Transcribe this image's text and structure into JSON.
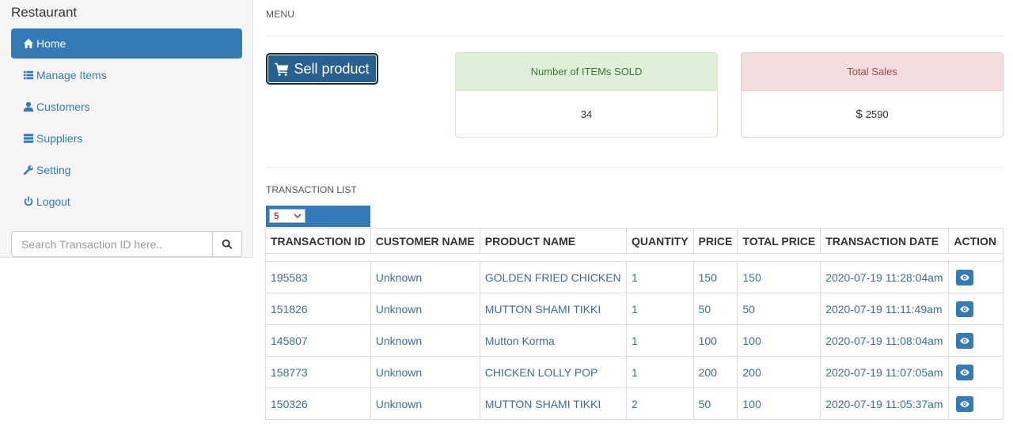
{
  "sidebar": {
    "brand": "Restaurant",
    "items": [
      {
        "label": "Home",
        "icon": "home-icon",
        "active": true
      },
      {
        "label": "Manage Items",
        "icon": "list-icon",
        "active": false
      },
      {
        "label": "Customers",
        "icon": "user-icon",
        "active": false
      },
      {
        "label": "Suppliers",
        "icon": "server-icon",
        "active": false
      },
      {
        "label": "Setting",
        "icon": "wrench-icon",
        "active": false
      },
      {
        "label": "Logout",
        "icon": "power-icon",
        "active": false
      }
    ],
    "search": {
      "placeholder": "Search Transaction ID here..",
      "value": ""
    }
  },
  "main": {
    "title": "MENU",
    "sell_button": "Sell product",
    "items_sold": {
      "label": "Number of ITEMs SOLD",
      "value": "34"
    },
    "total_sales": {
      "label": "Total Sales",
      "currency": "$",
      "value": "2590"
    },
    "list_title": "TRANSACTION LIST",
    "page_size": "5",
    "columns": [
      "TRANSACTION ID",
      "CUSTOMER NAME",
      "PRODUCT NAME",
      "QUANTITY",
      "PRICE",
      "TOTAL PRICE",
      "TRANSACTION DATE",
      "ACTION"
    ],
    "rows": [
      {
        "id": "195583",
        "customer": "Unknown",
        "product": "GOLDEN FRIED CHICKEN",
        "qty": "1",
        "price": "150",
        "total": "150",
        "date": "2020-07-19 11:28:04am"
      },
      {
        "id": "151826",
        "customer": "Unknown",
        "product": "MUTTON SHAMI TIKKI",
        "qty": "1",
        "price": "50",
        "total": "50",
        "date": "2020-07-19 11:11:49am"
      },
      {
        "id": "145807",
        "customer": "Unknown",
        "product": "Mutton Korma",
        "qty": "1",
        "price": "100",
        "total": "100",
        "date": "2020-07-19 11:08:04am"
      },
      {
        "id": "158773",
        "customer": "Unknown",
        "product": "CHICKEN LOLLY POP",
        "qty": "1",
        "price": "200",
        "total": "200",
        "date": "2020-07-19 11:07:05am"
      },
      {
        "id": "150326",
        "customer": "Unknown",
        "product": "MUTTON SHAMI TIKKI",
        "qty": "2",
        "price": "50",
        "total": "100",
        "date": "2020-07-19 11:05:37am"
      }
    ]
  },
  "colors": {
    "primary": "#337ab7",
    "primary_dark": "#286090",
    "success_bg": "#dff0d8",
    "danger_bg": "#f2dede",
    "link": "#3a6f96"
  }
}
